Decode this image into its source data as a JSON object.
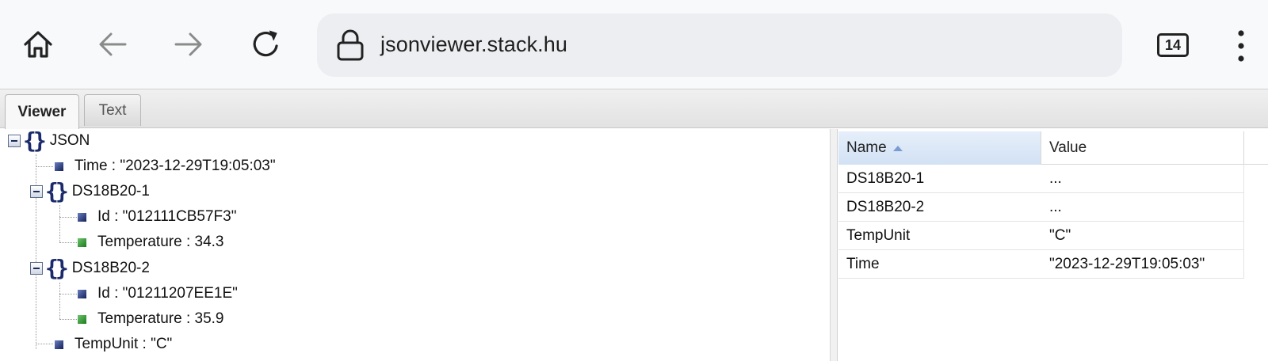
{
  "browser": {
    "url": "jsonviewer.stack.hu",
    "tab_count": "14"
  },
  "app_tabs": [
    {
      "label": "Viewer",
      "active": true
    },
    {
      "label": "Text",
      "active": false
    }
  ],
  "tree": {
    "root_label": "JSON",
    "nodes": [
      {
        "text": "Time : \"2023-12-29T19:05:03\"",
        "type": "string"
      },
      {
        "text": "DS18B20-1",
        "type": "object"
      },
      {
        "text": "Id : \"012111CB57F3\"",
        "type": "string"
      },
      {
        "text": "Temperature : 34.3",
        "type": "number"
      },
      {
        "text": "DS18B20-2",
        "type": "object"
      },
      {
        "text": "Id : \"01211207EE1E\"",
        "type": "string"
      },
      {
        "text": "Temperature : 35.9",
        "type": "number"
      },
      {
        "text": "TempUnit : \"C\"",
        "type": "string"
      }
    ]
  },
  "grid": {
    "headers": {
      "name": "Name",
      "value": "Value"
    },
    "rows": [
      {
        "name": "DS18B20-1",
        "value": "..."
      },
      {
        "name": "DS18B20-2",
        "value": "..."
      },
      {
        "name": "TempUnit",
        "value": "\"C\""
      },
      {
        "name": "Time",
        "value": "\"2023-12-29T19:05:03\""
      }
    ]
  },
  "icons": {
    "home": "home-icon",
    "back": "back-arrow-icon",
    "forward": "forward-arrow-icon",
    "reload": "reload-icon",
    "lock": "lock-icon",
    "tabs": "tab-switcher-icon",
    "menu": "more-vert-icon",
    "object": "braces-icon",
    "collapse": "collapse-icon",
    "string_leaf": "string-node-icon",
    "number_leaf": "number-node-icon"
  },
  "colors": {
    "toolbar_bg": "#f8f9fb",
    "urlbar_bg": "#eceef1",
    "sorted_header": "#d2e1f5",
    "string_node": "#14205a",
    "number_node": "#1a7a1a"
  }
}
